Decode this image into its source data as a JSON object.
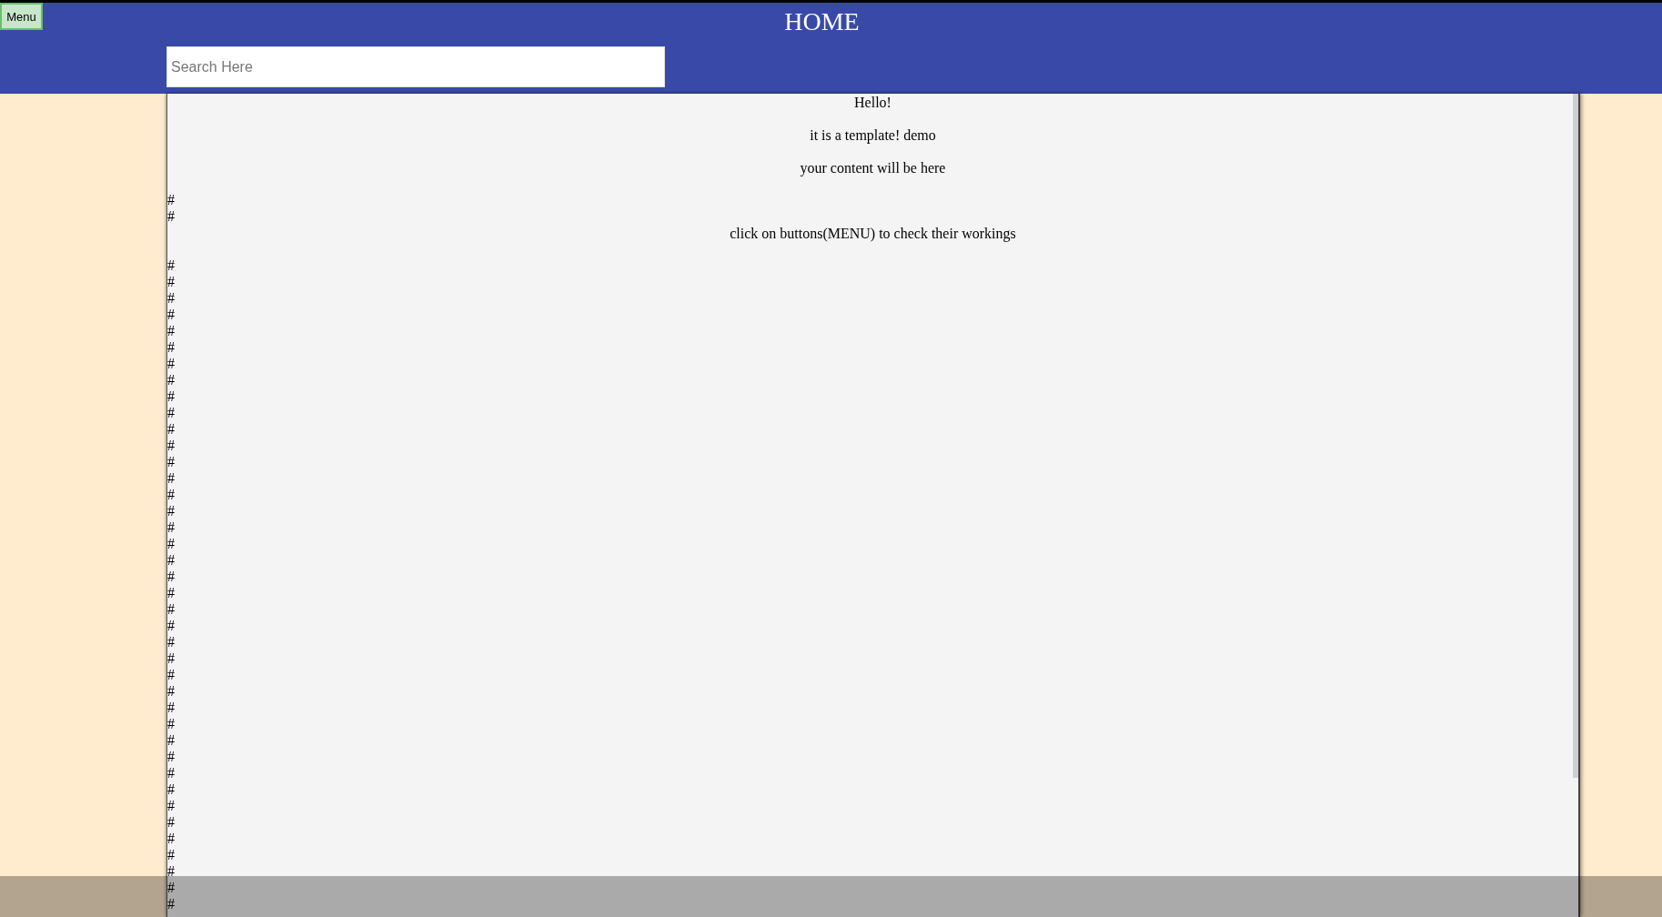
{
  "header": {
    "menu_button": "Menu",
    "title": "HOME",
    "search": {
      "placeholder": "Search Here"
    }
  },
  "content": [
    {
      "kind": "paragraph",
      "text": "Hello!"
    },
    {
      "kind": "paragraph",
      "text": "it is a template! demo"
    },
    {
      "kind": "paragraph",
      "text": "your content will be here"
    },
    {
      "kind": "hash",
      "text": "#"
    },
    {
      "kind": "hash",
      "text": "#"
    },
    {
      "kind": "paragraph",
      "text": "click on buttons(MENU) to check their workings"
    },
    {
      "kind": "hash",
      "text": "#"
    },
    {
      "kind": "hash",
      "text": "#"
    },
    {
      "kind": "hash",
      "text": "#"
    },
    {
      "kind": "hash",
      "text": "#"
    },
    {
      "kind": "hash",
      "text": "#"
    },
    {
      "kind": "hash",
      "text": "#"
    },
    {
      "kind": "hash",
      "text": "#"
    },
    {
      "kind": "hash",
      "text": "#"
    },
    {
      "kind": "hash",
      "text": "#"
    },
    {
      "kind": "hash",
      "text": "#"
    },
    {
      "kind": "hash",
      "text": "#"
    },
    {
      "kind": "hash",
      "text": "#"
    },
    {
      "kind": "hash",
      "text": "#"
    },
    {
      "kind": "hash",
      "text": "#"
    },
    {
      "kind": "hash",
      "text": "#"
    },
    {
      "kind": "hash",
      "text": "#"
    },
    {
      "kind": "hash",
      "text": "#"
    },
    {
      "kind": "hash",
      "text": "#"
    },
    {
      "kind": "hash",
      "text": "#"
    },
    {
      "kind": "hash",
      "text": "#"
    },
    {
      "kind": "hash",
      "text": "#"
    },
    {
      "kind": "hash",
      "text": "#"
    },
    {
      "kind": "hash",
      "text": "#"
    },
    {
      "kind": "hash",
      "text": "#"
    },
    {
      "kind": "hash",
      "text": "#"
    },
    {
      "kind": "hash",
      "text": "#"
    },
    {
      "kind": "hash",
      "text": "#"
    },
    {
      "kind": "hash",
      "text": "#"
    },
    {
      "kind": "hash",
      "text": "#"
    },
    {
      "kind": "hash",
      "text": "#"
    },
    {
      "kind": "hash",
      "text": "#"
    },
    {
      "kind": "hash",
      "text": "#"
    },
    {
      "kind": "hash",
      "text": "#"
    },
    {
      "kind": "hash",
      "text": "#"
    },
    {
      "kind": "hash",
      "text": "#"
    },
    {
      "kind": "hash",
      "text": "#"
    },
    {
      "kind": "hash",
      "text": "#"
    },
    {
      "kind": "hash",
      "text": "#"
    },
    {
      "kind": "hash",
      "text": "#"
    },
    {
      "kind": "hash",
      "text": "#"
    }
  ]
}
